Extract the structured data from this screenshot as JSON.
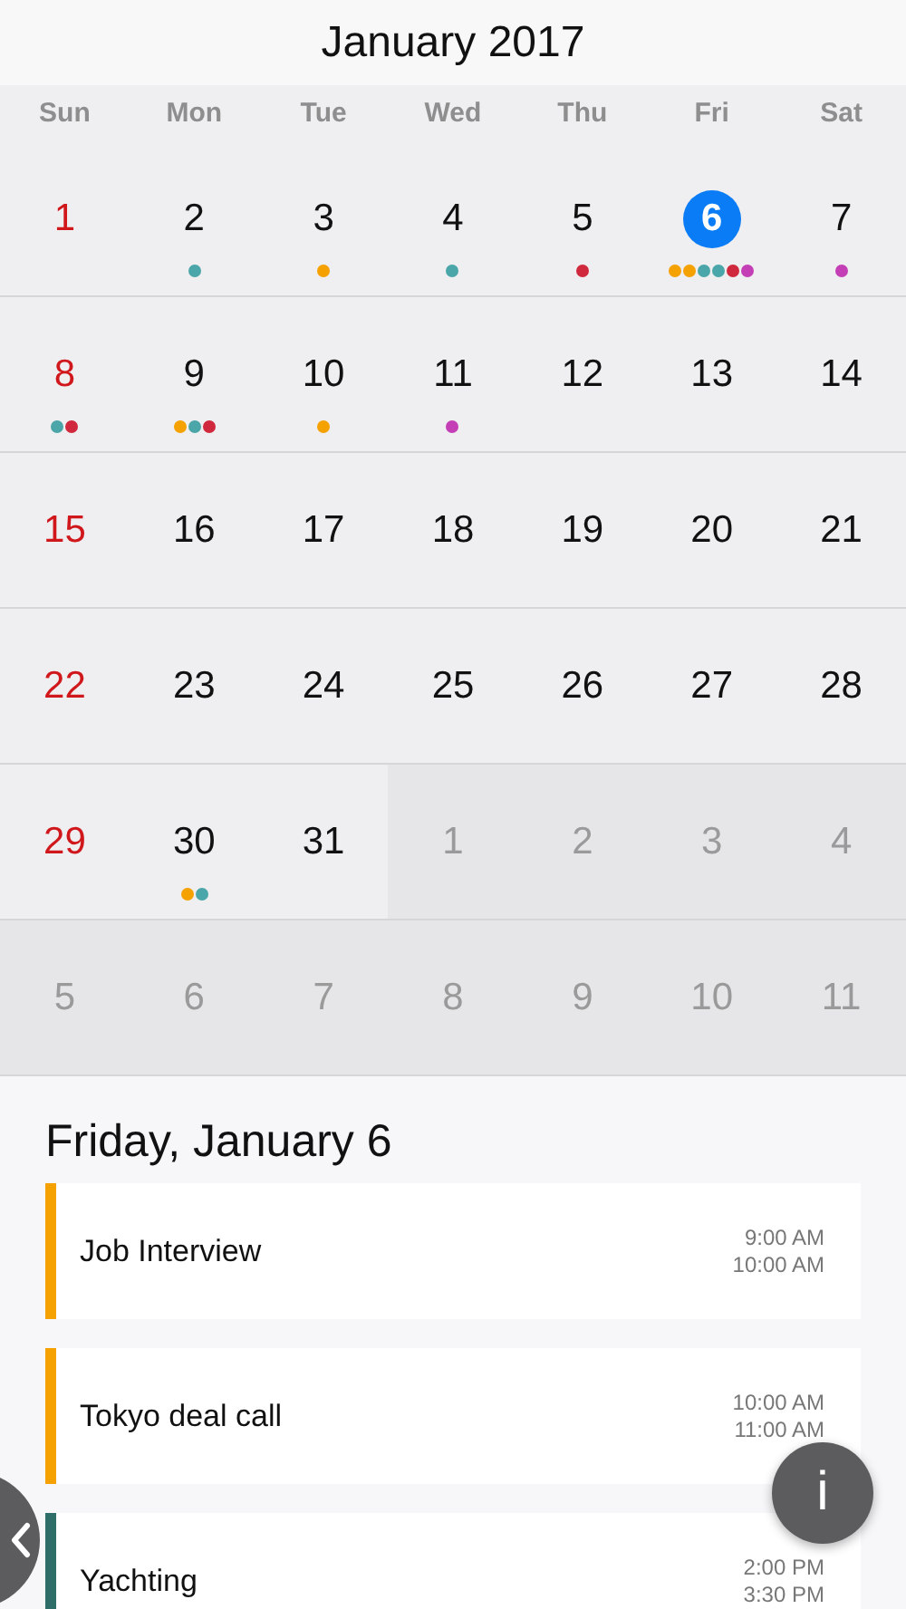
{
  "title": "January 2017",
  "weekdays": [
    "Sun",
    "Mon",
    "Tue",
    "Wed",
    "Thu",
    "Fri",
    "Sat"
  ],
  "weeks": [
    {
      "days": [
        {
          "number": "1",
          "kind": "sunday",
          "selected": false
        },
        {
          "number": "2",
          "kind": "weekday",
          "selected": false,
          "dots": [
            {
              "color": "#4aa6a8"
            }
          ]
        },
        {
          "number": "3",
          "kind": "weekday",
          "selected": false,
          "dots": [
            {
              "color": "#f5a100"
            }
          ]
        },
        {
          "number": "4",
          "kind": "weekday",
          "selected": false,
          "dots": [
            {
              "color": "#4aa6a8"
            }
          ]
        },
        {
          "number": "5",
          "kind": "weekday",
          "selected": false,
          "dots": [
            {
              "color": "#d0283c"
            }
          ]
        },
        {
          "number": "6",
          "kind": "weekday",
          "selected": true,
          "dots": [
            {
              "color": "#f5a100"
            },
            {
              "color": "#f5a100"
            },
            {
              "color": "#4aa6a8"
            },
            {
              "color": "#4aa6a8"
            },
            {
              "color": "#d0283c"
            },
            {
              "color": "#c43fb5"
            }
          ]
        },
        {
          "number": "7",
          "kind": "weekday",
          "selected": false,
          "dots": [
            {
              "color": "#c43fb5"
            }
          ]
        }
      ]
    },
    {
      "days": [
        {
          "number": "8",
          "kind": "sunday",
          "selected": false,
          "dots": [
            {
              "color": "#4aa6a8"
            },
            {
              "color": "#d0283c"
            }
          ]
        },
        {
          "number": "9",
          "kind": "weekday",
          "selected": false,
          "dots": [
            {
              "color": "#f5a100"
            },
            {
              "color": "#4aa6a8"
            },
            {
              "color": "#d0283c"
            }
          ]
        },
        {
          "number": "10",
          "kind": "weekday",
          "selected": false,
          "dots": [
            {
              "color": "#f5a100"
            }
          ]
        },
        {
          "number": "11",
          "kind": "weekday",
          "selected": false,
          "dots": [
            {
              "color": "#c43fb5"
            }
          ]
        },
        {
          "number": "12",
          "kind": "weekday",
          "selected": false
        },
        {
          "number": "13",
          "kind": "weekday",
          "selected": false
        },
        {
          "number": "14",
          "kind": "weekday",
          "selected": false
        }
      ]
    },
    {
      "days": [
        {
          "number": "15",
          "kind": "sunday",
          "selected": false
        },
        {
          "number": "16",
          "kind": "weekday",
          "selected": false
        },
        {
          "number": "17",
          "kind": "weekday",
          "selected": false
        },
        {
          "number": "18",
          "kind": "weekday",
          "selected": false
        },
        {
          "number": "19",
          "kind": "weekday",
          "selected": false
        },
        {
          "number": "20",
          "kind": "weekday",
          "selected": false
        },
        {
          "number": "21",
          "kind": "weekday",
          "selected": false
        }
      ]
    },
    {
      "days": [
        {
          "number": "22",
          "kind": "sunday",
          "selected": false
        },
        {
          "number": "23",
          "kind": "weekday",
          "selected": false
        },
        {
          "number": "24",
          "kind": "weekday",
          "selected": false
        },
        {
          "number": "25",
          "kind": "weekday",
          "selected": false
        },
        {
          "number": "26",
          "kind": "weekday",
          "selected": false
        },
        {
          "number": "27",
          "kind": "weekday",
          "selected": false
        },
        {
          "number": "28",
          "kind": "weekday",
          "selected": false
        }
      ]
    },
    {
      "days": [
        {
          "number": "29",
          "kind": "sunday",
          "selected": false
        },
        {
          "number": "30",
          "kind": "weekday",
          "selected": false,
          "dots": [
            {
              "color": "#f5a100"
            },
            {
              "color": "#4aa6a8"
            }
          ]
        },
        {
          "number": "31",
          "kind": "weekday",
          "selected": false
        },
        {
          "number": "1",
          "kind": "other",
          "selected": false
        },
        {
          "number": "2",
          "kind": "other",
          "selected": false
        },
        {
          "number": "3",
          "kind": "other",
          "selected": false
        },
        {
          "number": "4",
          "kind": "other",
          "selected": false
        }
      ]
    },
    {
      "days": [
        {
          "number": "5",
          "kind": "other",
          "selected": false
        },
        {
          "number": "6",
          "kind": "other",
          "selected": false
        },
        {
          "number": "7",
          "kind": "other",
          "selected": false
        },
        {
          "number": "8",
          "kind": "other",
          "selected": false
        },
        {
          "number": "9",
          "kind": "other",
          "selected": false
        },
        {
          "number": "10",
          "kind": "other",
          "selected": false
        },
        {
          "number": "11",
          "kind": "other",
          "selected": false
        }
      ]
    }
  ],
  "agenda": {
    "heading": "Friday, January 6",
    "events": [
      {
        "title": "Job Interview",
        "start": "9:00 AM",
        "end": "10:00 AM",
        "color": "#f5a100"
      },
      {
        "title": "Tokyo deal call",
        "start": "10:00 AM",
        "end": "11:00 AM",
        "color": "#f5a100"
      },
      {
        "title": "Yachting",
        "start": "2:00 PM",
        "end": "3:30 PM",
        "color": "#2f6e68"
      }
    ]
  },
  "info_button": {
    "label": "i"
  }
}
